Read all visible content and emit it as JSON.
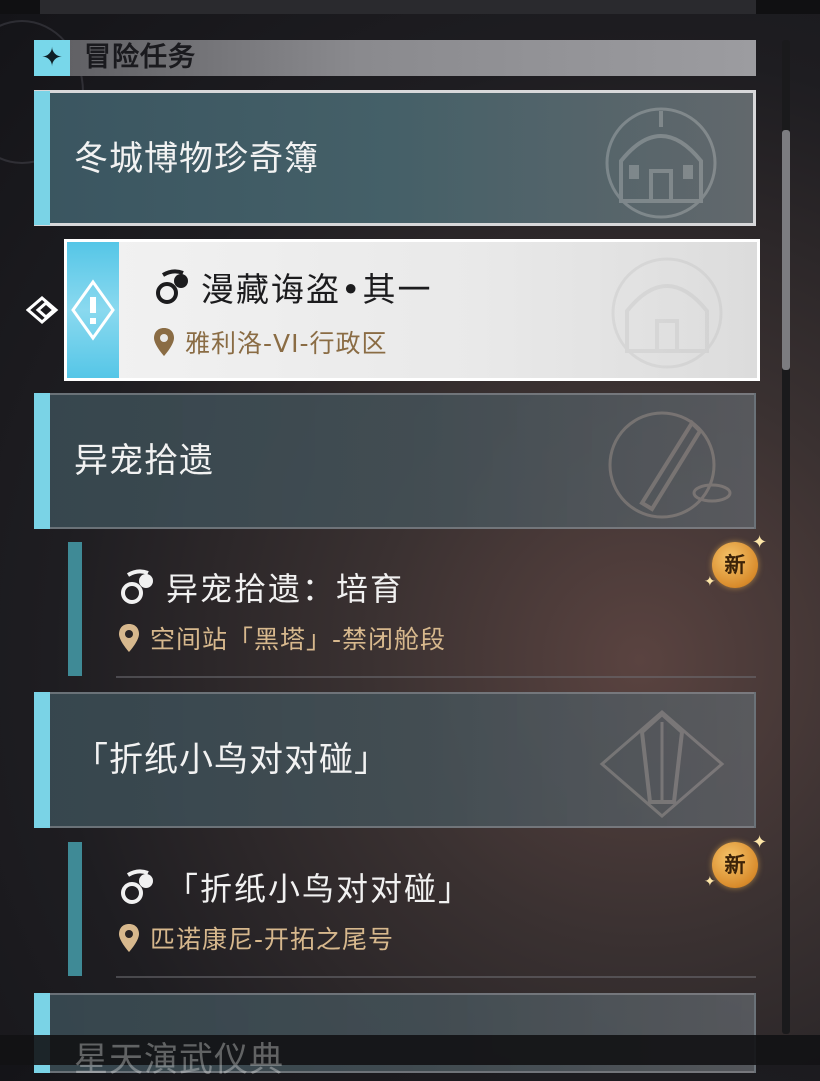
{
  "section": {
    "title": "冒险任务",
    "icon": "sparkle-star-icon"
  },
  "categories": [
    {
      "title": "冬城博物珍奇簿",
      "emblem": "museum-dome-emblem"
    },
    {
      "title": "异宠拾遗",
      "emblem": "rocket-emblem"
    },
    {
      "title": "「折纸小鸟对对碰」",
      "emblem": "paper-bird-emblem"
    },
    {
      "title": "星天演武仪典"
    }
  ],
  "quests": [
    {
      "title": "漫藏诲盗•其一",
      "location": "雅利洛-VI-行政区",
      "selected": true
    },
    {
      "title": "异宠拾遗：培育",
      "location": "空间站「黑塔」-禁闭舱段",
      "badge": "新"
    },
    {
      "title": "「折纸小鸟对对碰」",
      "location": "匹诺康尼-开拓之尾号",
      "badge": "新"
    }
  ],
  "colors": {
    "accent": "#7ad3e6",
    "location_text": "#d7b88d",
    "badge": "#e0962e"
  }
}
